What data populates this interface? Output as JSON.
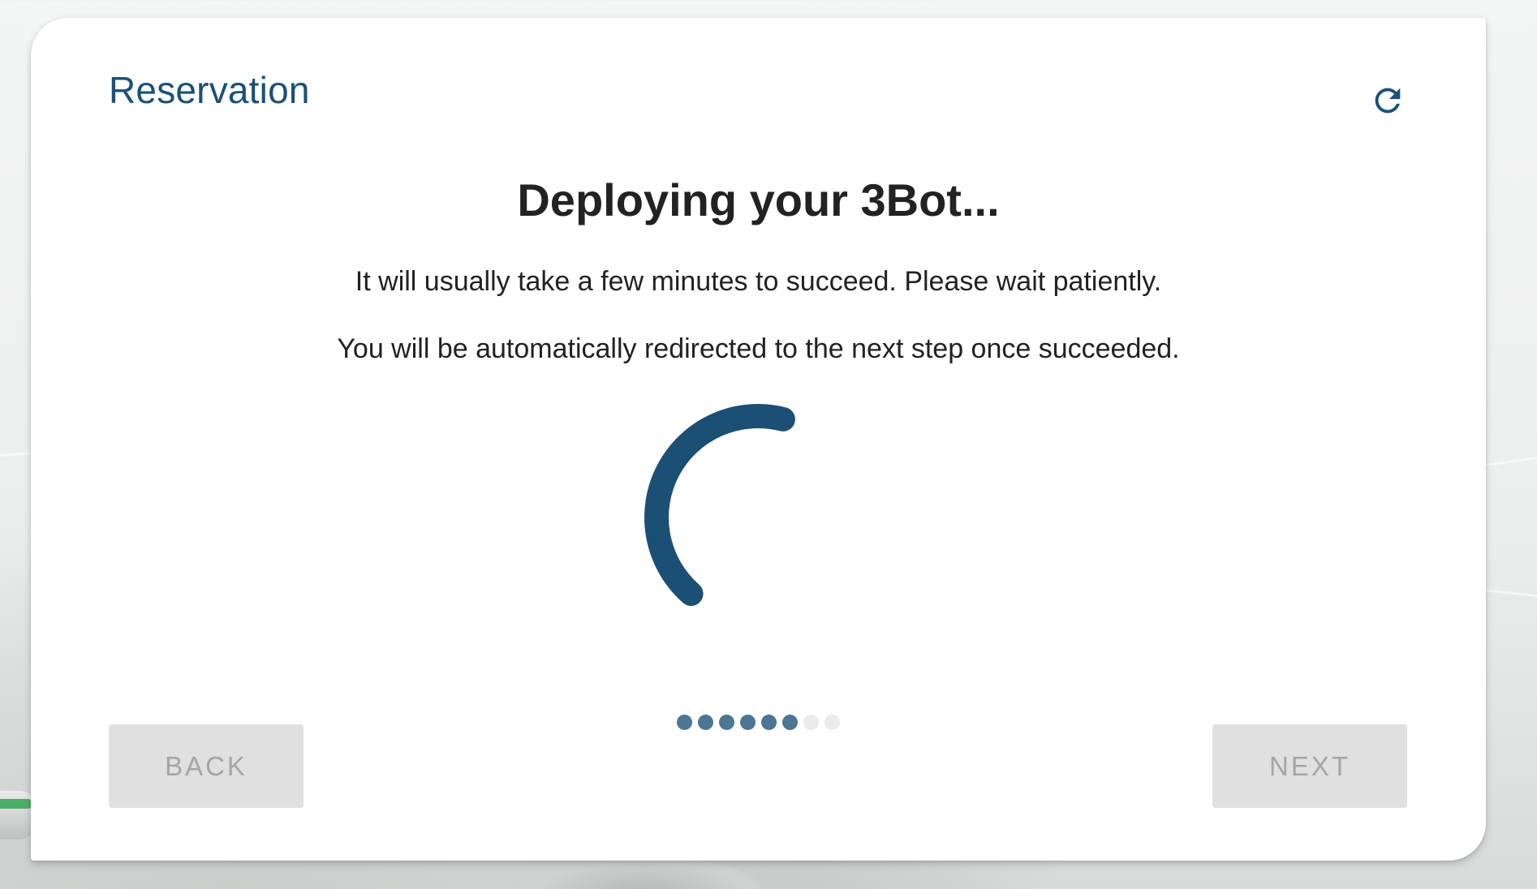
{
  "card": {
    "title": "Reservation",
    "refresh_icon": "refresh-icon"
  },
  "deploy": {
    "heading": "Deploying your 3Bot...",
    "message_1": "It will usually take a few minutes to succeed. Please wait patiently.",
    "message_2": "You will be automatically redirected to the next step once succeeded."
  },
  "spinner": {
    "icon": "loading-spinner-icon",
    "color": "#1c4f74"
  },
  "stepper": {
    "total_steps": 8,
    "completed_steps": 6,
    "active_color": "#4d7594",
    "pending_color": "#ebebeb"
  },
  "buttons": {
    "back_label": "BACK",
    "next_label": "NEXT",
    "back_disabled": true,
    "next_disabled": true
  },
  "theme": {
    "accent": "#1c5078",
    "text": "#222222",
    "disabled_bg": "#e0e0e0",
    "disabled_text": "#a5a5a5"
  }
}
